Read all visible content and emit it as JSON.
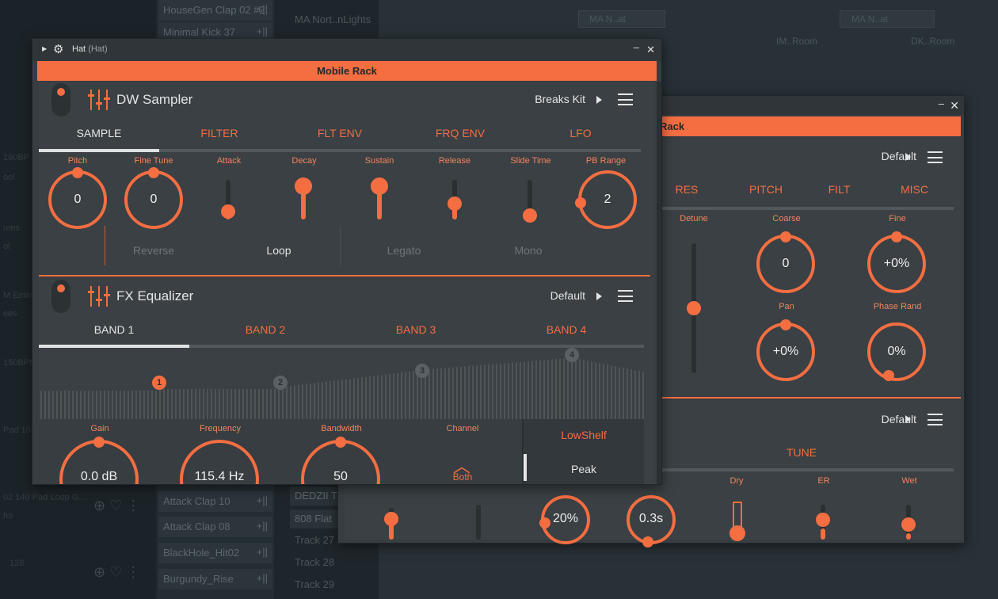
{
  "colors": {
    "accent": "#f46e42",
    "panel": "#373d41",
    "background": "#1f262b"
  },
  "background": {
    "left_texts": [
      "160BP",
      "ocl",
      "ums",
      "ol",
      "M Emin",
      "ees",
      "150BPM",
      "Pad 10",
      "02 140 Pad Loop G...",
      "ho",
      "128"
    ],
    "browser_items": [
      "HouseGen Clap 02 #2",
      "Minimal Kick 37",
      "Attack Clap 10",
      "Attack Clap 08",
      "BlackHole_Hit02",
      "Burgundy_Rise"
    ],
    "tracks": [
      "MA Nort..nLights",
      "DEDZII T",
      "808 Flat",
      "Track 27",
      "Track 28",
      "Track 29"
    ],
    "patterns": [
      "MA N..at",
      "MA N..at",
      "IM..Room",
      "IM..Room",
      "DK..Room"
    ]
  },
  "main_window": {
    "title": "Hat",
    "subtitle": "(Hat)",
    "rack_title": "Mobile Rack",
    "sampler": {
      "title": "DW Sampler",
      "preset": "Breaks Kit",
      "tabs": [
        "SAMPLE",
        "FILTER",
        "FLT ENV",
        "FRQ ENV",
        "LFO"
      ],
      "active_tab": "SAMPLE",
      "params": [
        "Pitch",
        "Fine Tune",
        "Attack",
        "Decay",
        "Sustain",
        "Release",
        "Slide Time",
        "PB Range"
      ],
      "pitch_value": "0",
      "finetune_value": "0",
      "pbrange_value": "2",
      "attack_level": 0.2,
      "decay_level": 0.85,
      "sustain_level": 0.85,
      "release_level": 0.4,
      "slide_level": 0.1,
      "switches": [
        "Reverse",
        "Loop",
        "Legato",
        "Mono"
      ],
      "active_switch": "Loop"
    },
    "equalizer": {
      "title": "FX Equalizer",
      "preset": "Default",
      "tabs": [
        "BAND 1",
        "BAND 2",
        "BAND 3",
        "BAND 4"
      ],
      "active_tab": "BAND 1",
      "band_markers": [
        "1",
        "2",
        "3",
        "4"
      ],
      "params": [
        "Gain",
        "Frequency",
        "Bandwidth",
        "Channel"
      ],
      "gain_value": "0.0 dB",
      "frequency_value": "115.4 Hz",
      "bandwidth_value": "50",
      "channel_value": "Both",
      "filter_types": [
        "LowShelf",
        "Peak"
      ],
      "active_filter": "Peak"
    }
  },
  "back_window": {
    "rack_title": "Rack",
    "preset_top": "Default",
    "tabs": [
      "RES",
      "PITCH",
      "FILT",
      "MISC"
    ],
    "params": [
      "Detune",
      "Coarse",
      "Fine",
      "Pan",
      "Phase Rand"
    ],
    "detune_level": 0.5,
    "coarse_value": "0",
    "fine_value": "+0%",
    "pan_value": "+0%",
    "phase_value": "0%",
    "preset_bottom": "Default",
    "bottom_tab": "TUNE",
    "bottom_params": [
      "Dry",
      "ER",
      "Wet"
    ],
    "knob_a_value": "20%",
    "knob_b_value": "0.3s"
  }
}
